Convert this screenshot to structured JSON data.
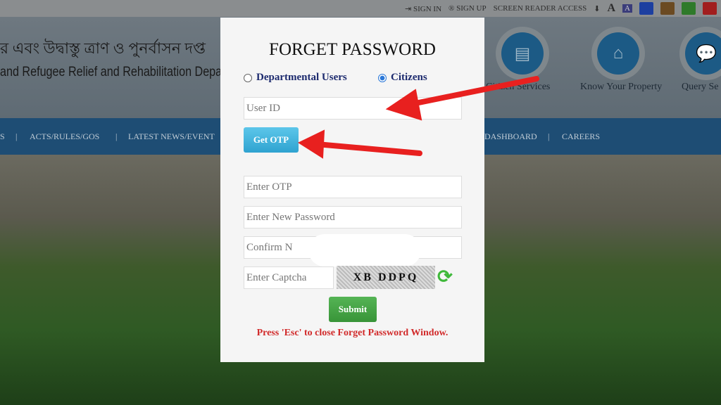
{
  "topbar": {
    "sign_in": "SIGN IN",
    "sign_up": "SIGN UP",
    "screen_reader": "SCREEN READER ACCESS",
    "colors": [
      "#1d3fa0",
      "#6b4a22",
      "#2f7a2a",
      "#a11e1e"
    ]
  },
  "header": {
    "bengali_title": "র এবং উদ্বাস্তু ত্রাণ ও পুনর্বাসন দপ্ত",
    "english_title": "and Refugee Relief and Rehabilitation Departm",
    "services": [
      {
        "label": "Citizen Services",
        "icon": "id-card-icon"
      },
      {
        "label": "Know Your Property",
        "icon": "home-icon"
      },
      {
        "label": "Query Se",
        "icon": "chat-icon"
      }
    ]
  },
  "nav": {
    "items": [
      "S",
      "ACTS/RULES/GOS",
      "LATEST NEWS/EVENT",
      "DASHBOARD",
      "CAREERS"
    ]
  },
  "modal": {
    "title": "FORGET PASSWORD",
    "radios": [
      {
        "label": "Departmental Users",
        "checked": false
      },
      {
        "label": "Citizens",
        "checked": true
      }
    ],
    "user_id_placeholder": "User ID",
    "get_otp": "Get OTP",
    "otp_placeholder": "Enter OTP",
    "new_password_placeholder": "Enter New Password",
    "confirm_placeholder": "Confirm N",
    "captcha_placeholder": "Enter Captcha",
    "captcha_text": "XB DDPQ",
    "submit": "Submit",
    "esc_note": "Press 'Esc' to close Forget Password Window."
  },
  "colors": {
    "arrow": "#e8201f",
    "get_otp": "#3fb2dc",
    "submit": "#3d9c3d",
    "note": "#d12a2a"
  }
}
